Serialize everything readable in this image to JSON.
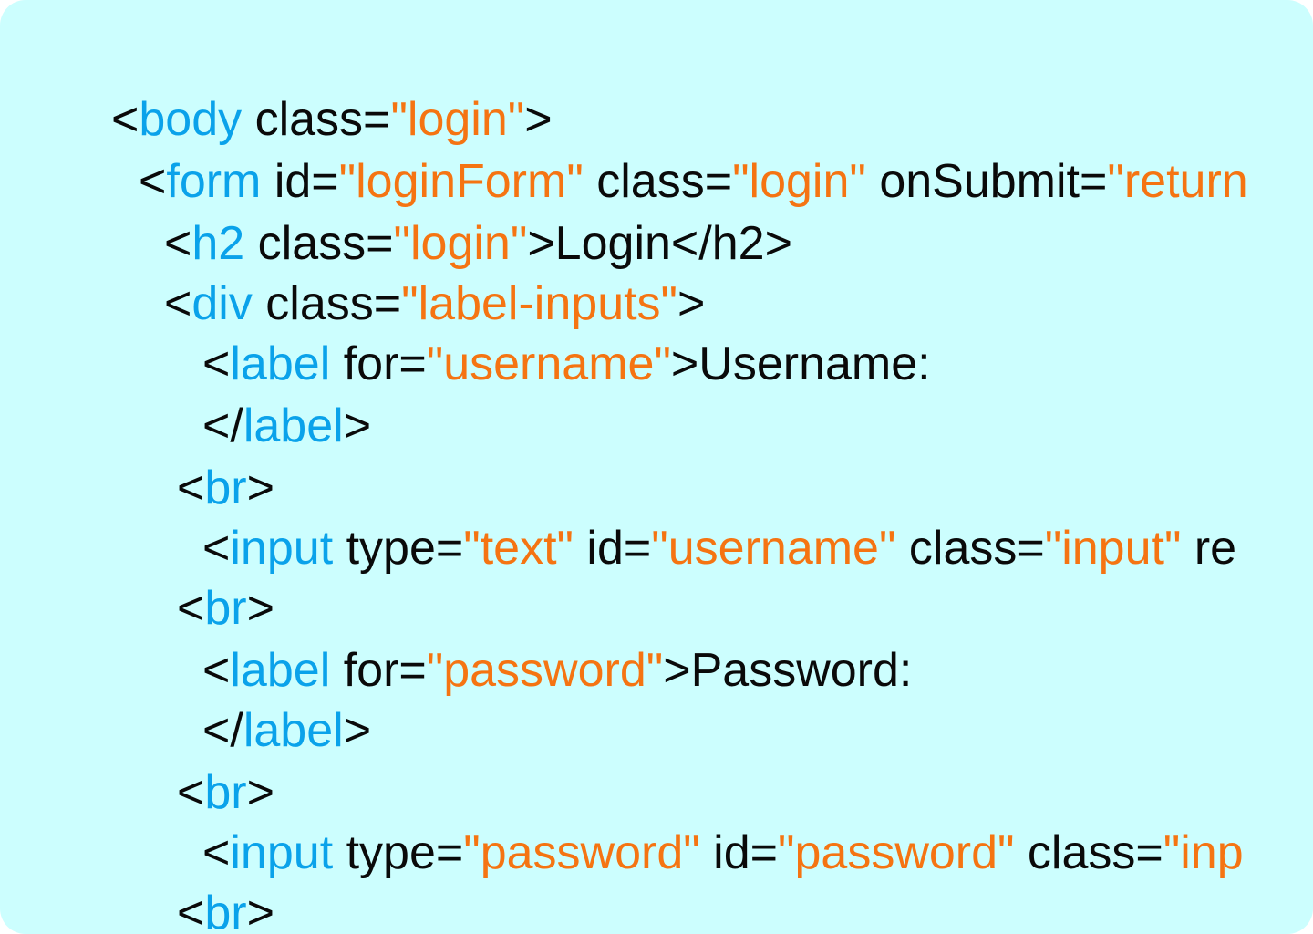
{
  "colors": {
    "background": "#ccfefe",
    "tag": "#0aa2ea",
    "string": "#f57412",
    "text": "#0a0a0a"
  },
  "code_lines": [
    [
      {
        "t": "pun",
        "v": "<"
      },
      {
        "t": "tag",
        "v": "body"
      },
      {
        "t": "att",
        "v": " class="
      },
      {
        "t": "str",
        "v": "\"login\""
      },
      {
        "t": "pun",
        "v": ">"
      }
    ],
    [
      {
        "t": "pun",
        "v": "<"
      },
      {
        "t": "tag",
        "v": "form"
      },
      {
        "t": "att",
        "v": " id="
      },
      {
        "t": "str",
        "v": "\"loginForm\""
      },
      {
        "t": "att",
        "v": " class="
      },
      {
        "t": "str",
        "v": "\"login\""
      },
      {
        "t": "att",
        "v": " onSubmit="
      },
      {
        "t": "str",
        "v": "\"return"
      }
    ],
    [
      {
        "t": "pun",
        "v": "<"
      },
      {
        "t": "tag",
        "v": "h2"
      },
      {
        "t": "att",
        "v": " class="
      },
      {
        "t": "str",
        "v": "\"login\""
      },
      {
        "t": "txt",
        "v": ">Login</h2>"
      }
    ],
    [
      {
        "t": "pun",
        "v": "<"
      },
      {
        "t": "tag",
        "v": "div"
      },
      {
        "t": "att",
        "v": " class="
      },
      {
        "t": "str",
        "v": "\"label-inputs\""
      },
      {
        "t": "pun",
        "v": ">"
      }
    ],
    [
      {
        "t": "pun",
        "v": "<"
      },
      {
        "t": "tag",
        "v": "label"
      },
      {
        "t": "att",
        "v": " for="
      },
      {
        "t": "str",
        "v": "\"username\""
      },
      {
        "t": "txt",
        "v": ">Username:"
      }
    ],
    [
      {
        "t": "pun",
        "v": "</"
      },
      {
        "t": "tag",
        "v": "label"
      },
      {
        "t": "pun",
        "v": ">"
      }
    ],
    [
      {
        "t": "pun",
        "v": "<"
      },
      {
        "t": "tag",
        "v": "br"
      },
      {
        "t": "pun",
        "v": ">"
      }
    ],
    [
      {
        "t": "pun",
        "v": "<"
      },
      {
        "t": "tag",
        "v": "input"
      },
      {
        "t": "att",
        "v": " type="
      },
      {
        "t": "str",
        "v": "\"text\""
      },
      {
        "t": "att",
        "v": " id="
      },
      {
        "t": "str",
        "v": "\"username\""
      },
      {
        "t": "att",
        "v": " class="
      },
      {
        "t": "str",
        "v": "\"input\""
      },
      {
        "t": "att",
        "v": " re"
      }
    ],
    [
      {
        "t": "pun",
        "v": "<"
      },
      {
        "t": "tag",
        "v": "br"
      },
      {
        "t": "pun",
        "v": ">"
      }
    ],
    [
      {
        "t": "pun",
        "v": "<"
      },
      {
        "t": "tag",
        "v": "label"
      },
      {
        "t": "att",
        "v": " for="
      },
      {
        "t": "str",
        "v": "\"password\""
      },
      {
        "t": "txt",
        "v": ">Password:"
      }
    ],
    [
      {
        "t": "pun",
        "v": "</"
      },
      {
        "t": "tag",
        "v": "label"
      },
      {
        "t": "pun",
        "v": ">"
      }
    ],
    [
      {
        "t": "pun",
        "v": "<"
      },
      {
        "t": "tag",
        "v": "br"
      },
      {
        "t": "pun",
        "v": ">"
      }
    ],
    [
      {
        "t": "pun",
        "v": "<"
      },
      {
        "t": "tag",
        "v": "input"
      },
      {
        "t": "att",
        "v": " type="
      },
      {
        "t": "str",
        "v": "\"password\""
      },
      {
        "t": "att",
        "v": " id="
      },
      {
        "t": "str",
        "v": "\"password\""
      },
      {
        "t": "att",
        "v": " class="
      },
      {
        "t": "str",
        "v": "\"inp"
      }
    ],
    [
      {
        "t": "pun",
        "v": "<"
      },
      {
        "t": "tag",
        "v": "br"
      },
      {
        "t": "pun",
        "v": ">"
      }
    ]
  ]
}
